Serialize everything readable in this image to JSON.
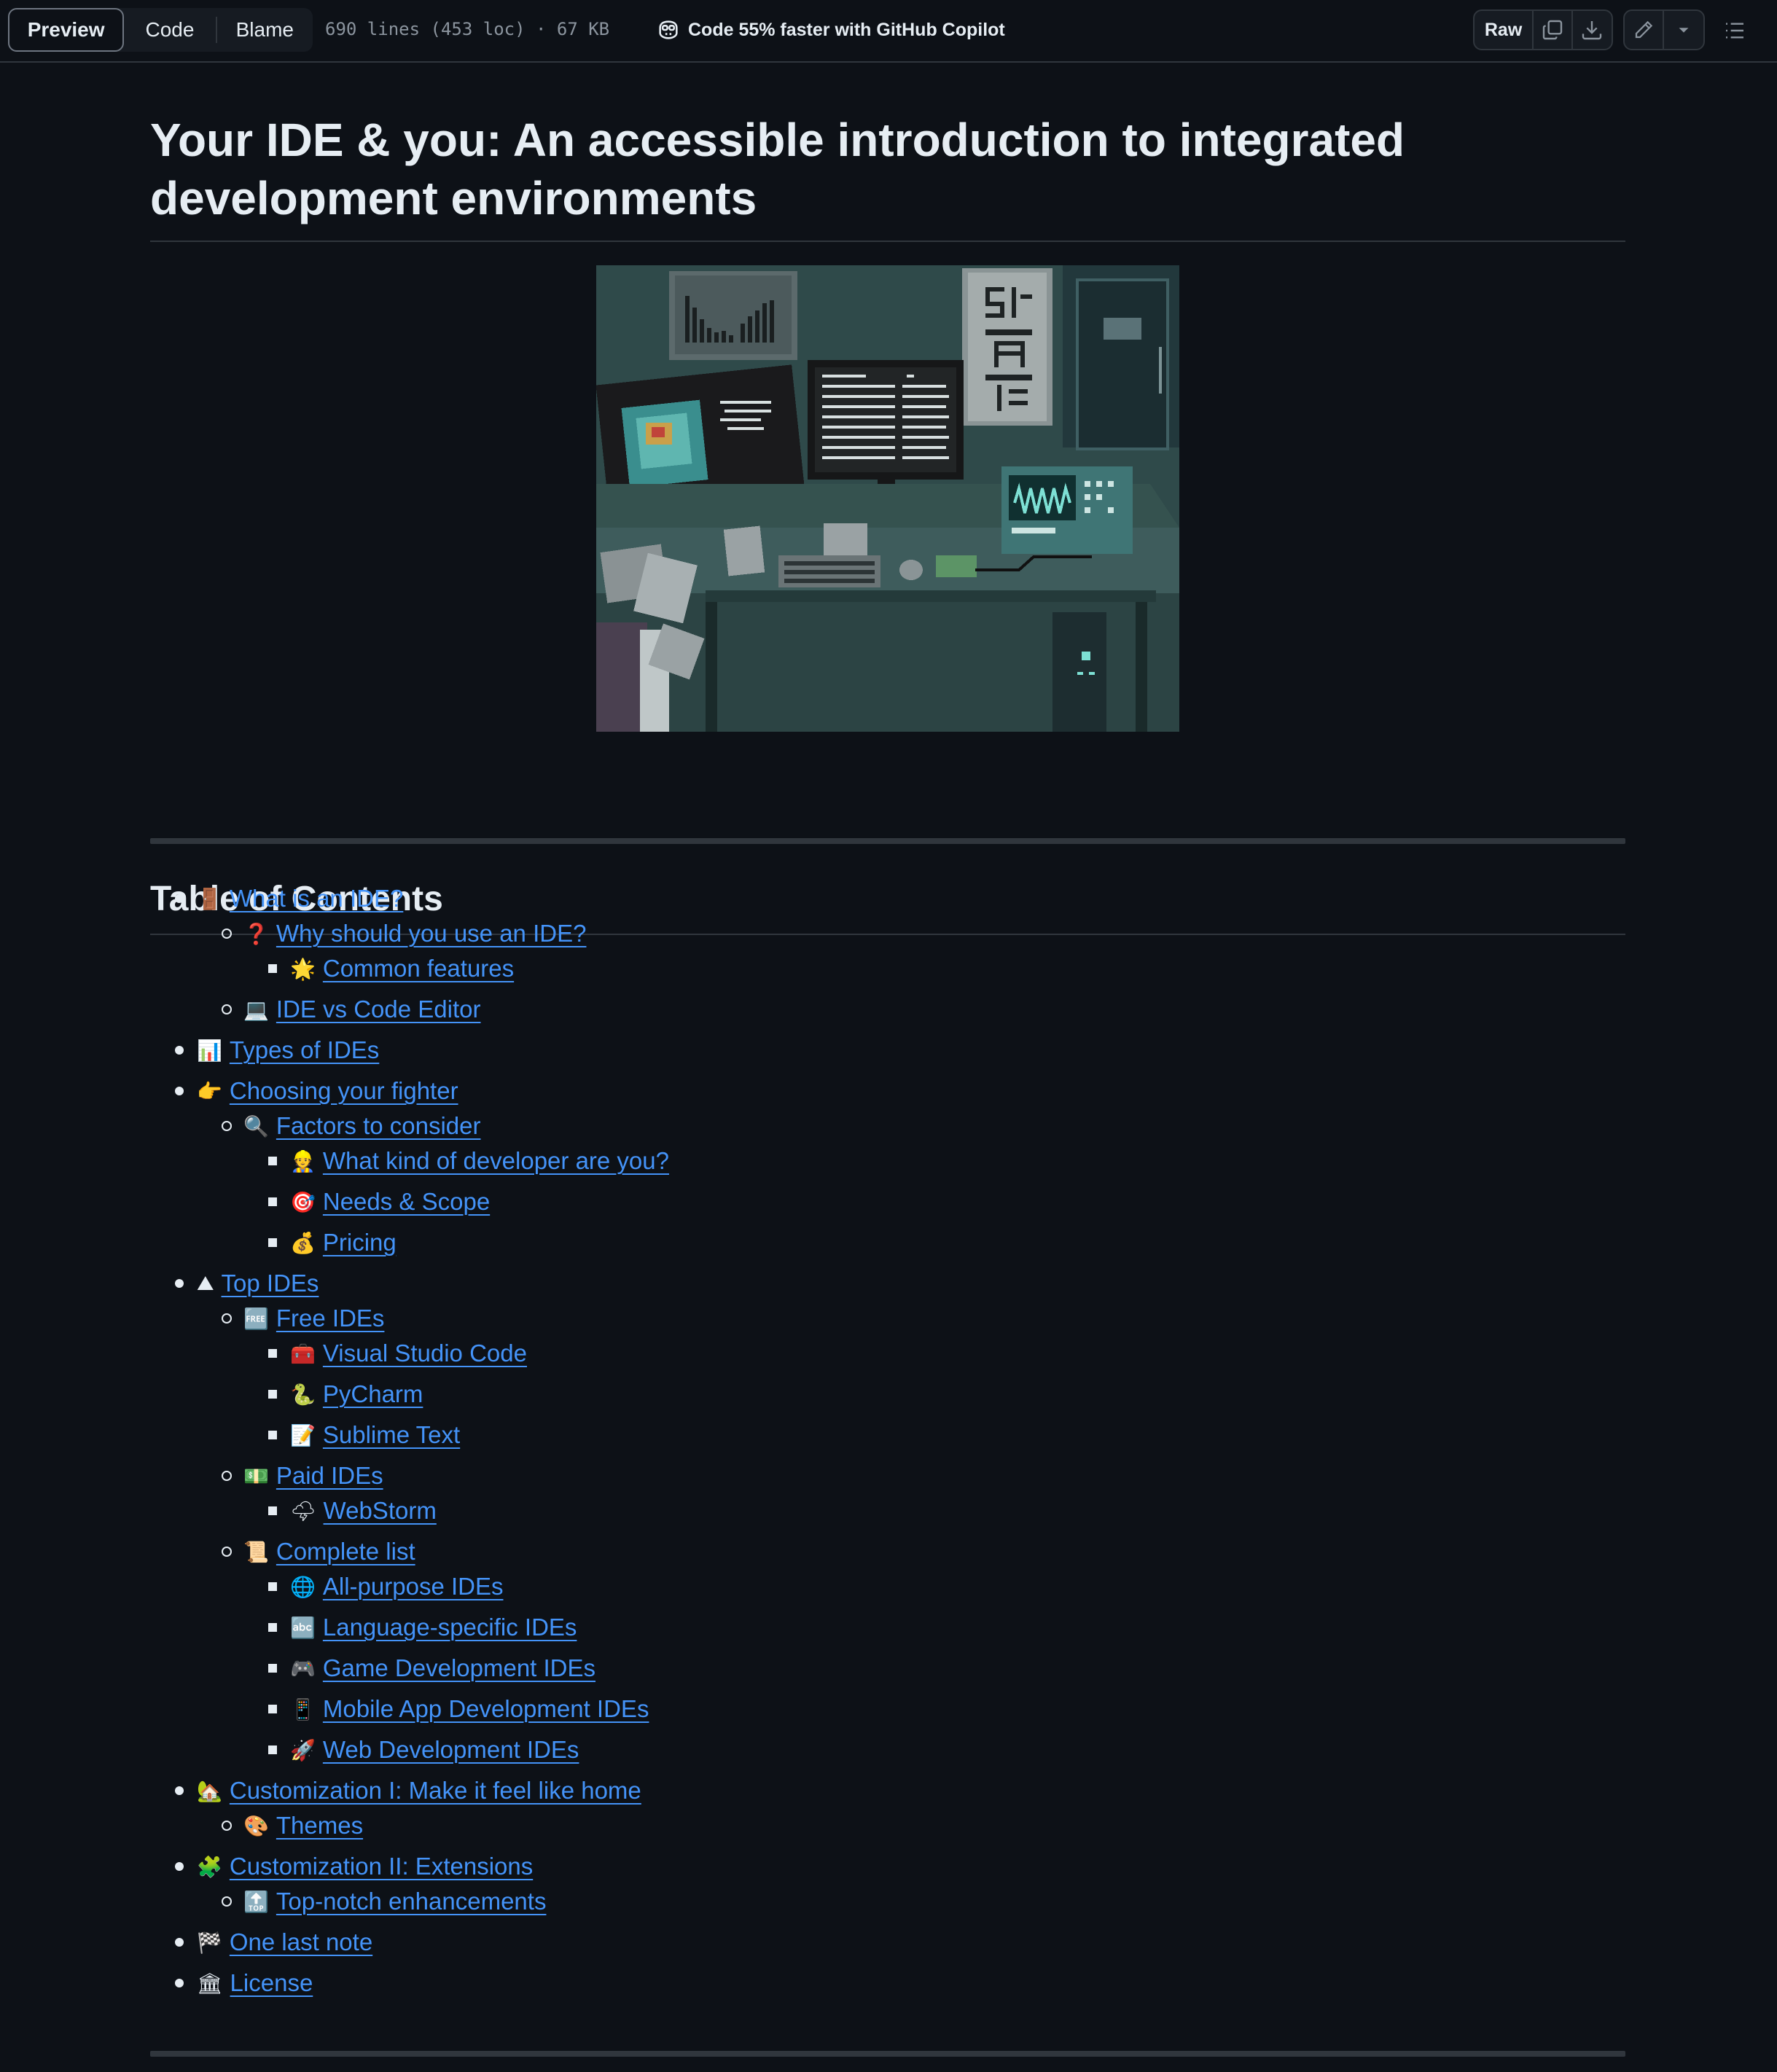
{
  "toolbar": {
    "tabs": [
      "Preview",
      "Code",
      "Blame"
    ],
    "file_meta": "690 lines (453 loc) · 67 KB",
    "copilot_promo": "Code 55% faster with GitHub Copilot",
    "raw_label": "Raw",
    "icons": [
      "copy-icon",
      "download-icon",
      "edit-pencil-icon",
      "chevron-down-icon",
      "outline-list-icon"
    ]
  },
  "readme": {
    "title": "Your IDE & you: An accessible introduction to integrated development environments",
    "hero_image": "pixel-art-developer-desk",
    "toc_heading": "Table of Contents",
    "toc": [
      {
        "level": 1,
        "emoji": "🚪",
        "text": "What is an IDE?"
      },
      {
        "level": 2,
        "emoji": "❓",
        "text": "Why should you use an IDE?"
      },
      {
        "level": 3,
        "emoji": "🌟",
        "text": "Common features"
      },
      {
        "level": 2,
        "emoji": "💻",
        "text": "IDE vs Code Editor"
      },
      {
        "level": 1,
        "emoji": "📊",
        "text": "Types of IDEs"
      },
      {
        "level": 1,
        "emoji": "👉",
        "text": "Choosing your fighter"
      },
      {
        "level": 2,
        "emoji": "🔍",
        "text": "Factors to consider"
      },
      {
        "level": 3,
        "emoji": "👷",
        "text": "What kind of developer are you?"
      },
      {
        "level": 3,
        "emoji": "🎯",
        "text": "Needs & Scope"
      },
      {
        "level": 3,
        "emoji": "💰",
        "text": "Pricing"
      },
      {
        "level": 1,
        "emoji": "⛰",
        "text": "Top IDEs"
      },
      {
        "level": 2,
        "emoji": "🆓",
        "text": "Free IDEs"
      },
      {
        "level": 3,
        "emoji": "🧰",
        "text": "Visual Studio Code"
      },
      {
        "level": 3,
        "emoji": "🐍",
        "text": "PyCharm"
      },
      {
        "level": 3,
        "emoji": "📝",
        "text": "Sublime Text"
      },
      {
        "level": 2,
        "emoji": "💵",
        "text": "Paid IDEs"
      },
      {
        "level": 3,
        "emoji": "🌩",
        "text": "WebStorm"
      },
      {
        "level": 2,
        "emoji": "📜",
        "text": "Complete list"
      },
      {
        "level": 3,
        "emoji": "🌐",
        "text": "All-purpose IDEs"
      },
      {
        "level": 3,
        "emoji": "🔤",
        "text": "Language-specific IDEs"
      },
      {
        "level": 3,
        "emoji": "🎮",
        "text": "Game Development IDEs"
      },
      {
        "level": 3,
        "emoji": "📱",
        "text": "Mobile App Development IDEs"
      },
      {
        "level": 3,
        "emoji": "🚀",
        "text": "Web Development IDEs"
      },
      {
        "level": 1,
        "emoji": "🏡",
        "text": "Customization I: Make it feel like home"
      },
      {
        "level": 2,
        "emoji": "🎨",
        "text": "Themes"
      },
      {
        "level": 1,
        "emoji": "🧩",
        "text": "Customization II: Extensions"
      },
      {
        "level": 2,
        "emoji": "🔝",
        "text": "Top-notch enhancements"
      },
      {
        "level": 1,
        "emoji": "🏁",
        "text": "One last note"
      },
      {
        "level": 1,
        "emoji": "🏛",
        "text": "License"
      }
    ]
  },
  "colors": {
    "background": "#0d1117",
    "text": "#e6edf3",
    "link": "#4493f8",
    "muted": "#8b949e",
    "border": "#30363d"
  }
}
